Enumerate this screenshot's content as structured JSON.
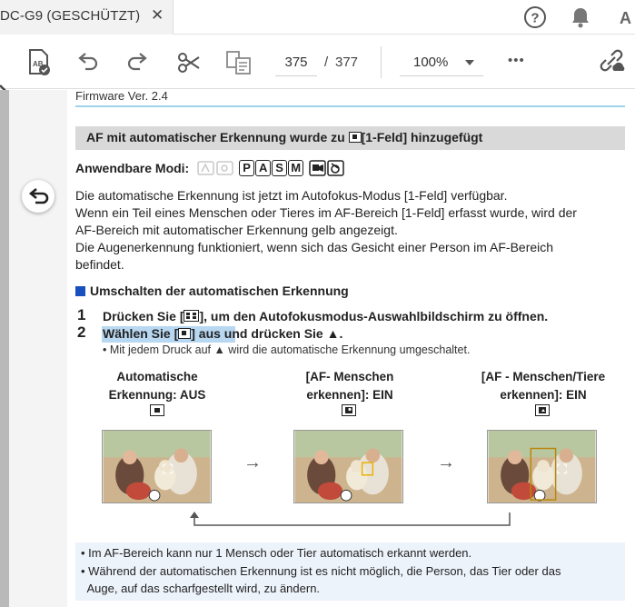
{
  "tab": {
    "title": "DC-G9 (GESCHÜTZT)",
    "close": "✕"
  },
  "topbar": {
    "help": "help-icon",
    "notifications": "bell-icon",
    "font": "A"
  },
  "toolbar": {
    "page_current": "375",
    "page_separator": "/",
    "page_total": "377",
    "zoom": "100%",
    "more": "•••"
  },
  "document": {
    "firmware": "Firmware Ver. 2.4",
    "heading_pre": "AF mit automatischer Erkennung wurde zu ",
    "heading_post": "[1-Feld] hinzugefügt",
    "modes_label": "Anwendbare Modi:",
    "modes": [
      "P",
      "A",
      "S",
      "M"
    ],
    "para": [
      "Die automatische Erkennung ist jetzt im Autofokus-Modus [1-Feld] verfügbar.",
      "Wenn ein Teil eines Menschen oder Tieres im AF-Bereich [1-Feld] erfasst wurde, wird der",
      "AF-Bereich mit automatischer Erkennung gelb angezeigt.",
      "Die Augenerkennung funktioniert, wenn sich das Gesicht einer Person im AF-Bereich",
      "befindet."
    ],
    "section_title": "Umschalten der automatischen Erkennung",
    "step1_num": "1",
    "step1_pre": "Drücken Sie [",
    "step1_post": "], um den Autofokusmodus-Auswahlbildschirm zu öffnen.",
    "step2_num": "2",
    "step2_pre": "Wählen Sie [",
    "step2_mid": "] aus",
    "step2_post": " und drücken Sie ▲.",
    "step2_note": "• Mit jedem Druck auf ▲ wird die automatische Erkennung umgeschaltet.",
    "captions": [
      {
        "line1": "Automatische",
        "line2": "Erkennung: AUS"
      },
      {
        "line1": "[AF- Menschen",
        "line2": "erkennen]: EIN"
      },
      {
        "line1": "[AF - Menschen/Tiere",
        "line2": "erkennen]: EIN"
      }
    ],
    "arrow": "→",
    "info": [
      "• Im AF-Bereich kann nur 1 Mensch oder Tier automatisch erkannt werden.",
      "• Während der automatischen Erkennung ist es nicht möglich, die Person, das Tier oder das",
      "  Auge, auf das scharfgestellt wird, zu ändern."
    ]
  }
}
